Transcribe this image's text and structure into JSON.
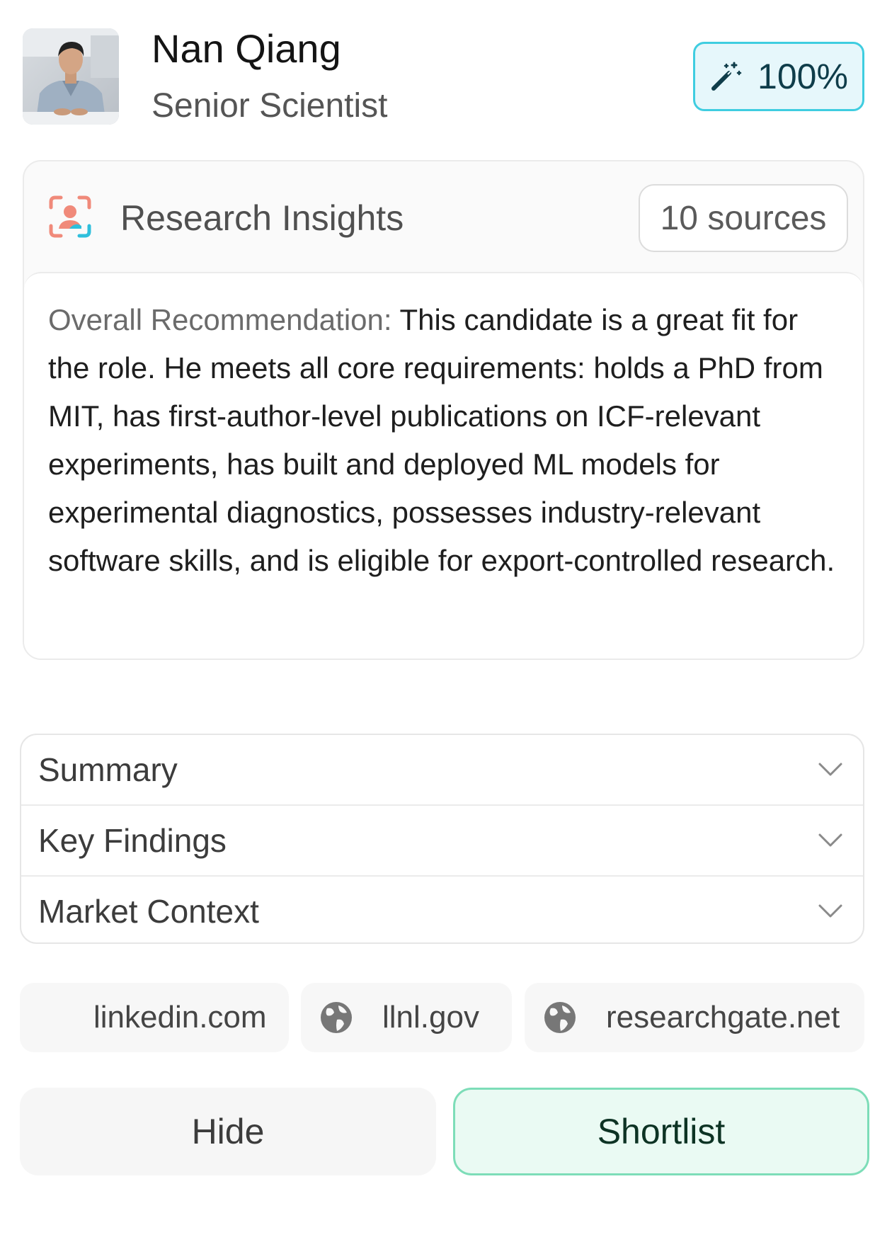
{
  "candidate": {
    "name": "Nan Qiang",
    "role": "Senior Scientist",
    "match_score": "100%",
    "avatar_icon": "profile-photo"
  },
  "insights": {
    "title": "Research Insights",
    "sources": "10 sources",
    "icon": "scan-person-icon",
    "recommendation_label": "Overall Recommendation:",
    "recommendation_text": " This candidate is a great fit for the role. He meets all core requirements: holds a PhD from MIT, has first-author-level publications on ICF-relevant experiments, has built and deployed ML models for experimental diagnostics, possesses industry-relevant software skills, and is eligible for export-controlled research."
  },
  "sections": [
    {
      "label": "Summary"
    },
    {
      "label": "Key Findings"
    },
    {
      "label": "Market Context"
    }
  ],
  "links": [
    {
      "label": "linkedin.com"
    },
    {
      "label": "llnl.gov",
      "icon": "globe-icon"
    },
    {
      "label": "researchgate.net",
      "icon": "globe-icon"
    }
  ],
  "actions": {
    "hide": "Hide",
    "shortlist": "Shortlist"
  },
  "colors": {
    "accent_cyan": "#3fcde0",
    "badge_bg": "#e6f7fb",
    "shortlist_border": "#7dddb8",
    "shortlist_bg": "#eafaf3"
  }
}
